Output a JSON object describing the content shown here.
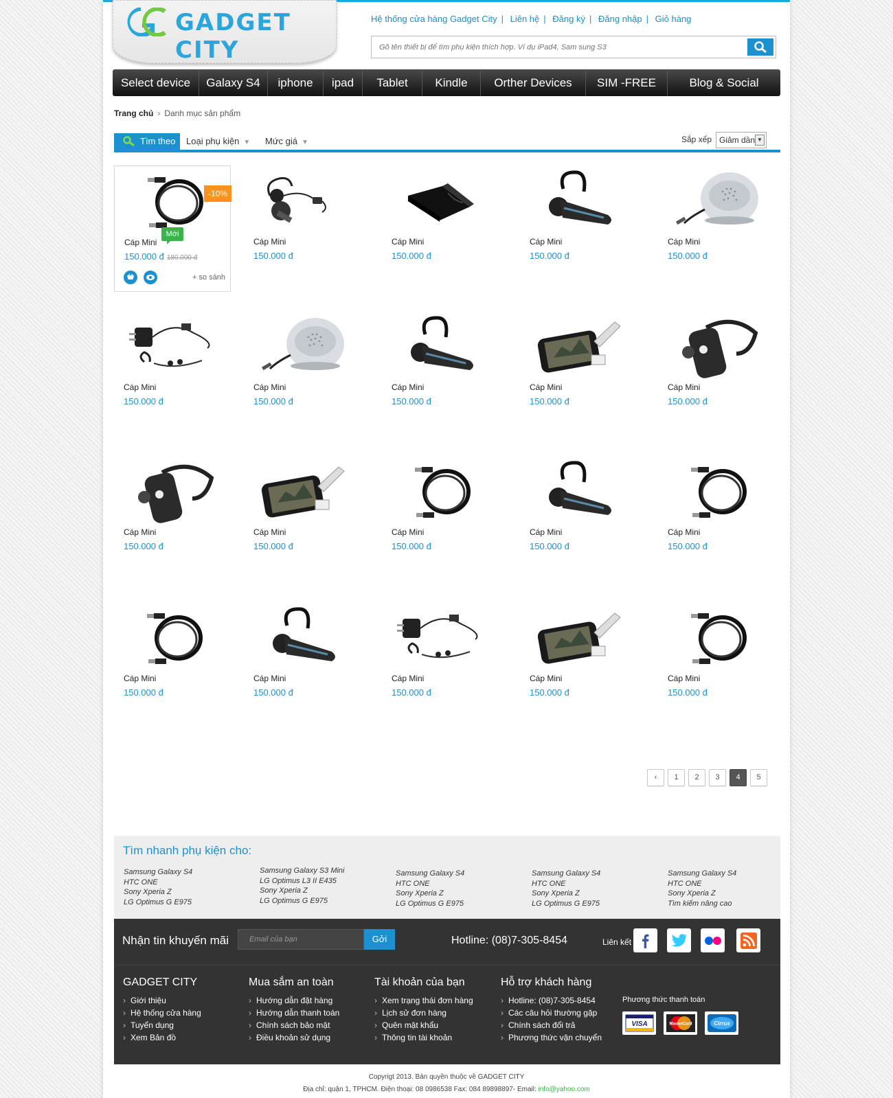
{
  "brand": {
    "name": "GADGET CITY",
    "mark": "GC"
  },
  "top_links": [
    "Hệ thống cửa hàng Gadget City",
    "Liên hệ",
    "Đăng ký",
    "Đăng nhập",
    "Giỏ hàng"
  ],
  "search": {
    "placeholder": "Gõ tên thiết bị để tìm phụ kiện thích hợp. Ví dụ iPad4, Sam sung S3"
  },
  "nav": [
    "Select device",
    "Galaxy S4",
    "iphone",
    "ipad",
    "Tablet",
    "Kindle",
    "Orther Devices",
    "SIM -FREE",
    "Blog & Social"
  ],
  "breadcrumb": {
    "home": "Trang chủ",
    "current": "Danh mục sản phẩm"
  },
  "filter": {
    "find_label": "Tìm theo",
    "type_label": "Loại phụ kiện",
    "price_label": "Mức giá",
    "sort_label": "Sắp xếp",
    "sort_value": "Giảm dần"
  },
  "featured": {
    "discount": "-10%",
    "new_badge": "Mới",
    "old_price": "180.000 đ",
    "compare": "+ so sánh"
  },
  "products": [
    {
      "name": "Cáp Mini",
      "price": "150.000 đ",
      "img": "cable"
    },
    {
      "name": "Cáp Mini",
      "price": "150.000 đ",
      "img": "handsfree"
    },
    {
      "name": "Cáp Mini",
      "price": "150.000 đ",
      "img": "case"
    },
    {
      "name": "Cáp Mini",
      "price": "150.000 đ",
      "img": "headset"
    },
    {
      "name": "Cáp Mini",
      "price": "150.000 đ",
      "img": "speaker"
    },
    {
      "name": "Cáp Mini",
      "price": "150.000 đ",
      "img": "charger"
    },
    {
      "name": "Cáp Mini",
      "price": "150.000 đ",
      "img": "speaker"
    },
    {
      "name": "Cáp Mini",
      "price": "150.000 đ",
      "img": "headset"
    },
    {
      "name": "Cáp Mini",
      "price": "150.000 đ",
      "img": "phone"
    },
    {
      "name": "Cáp Mini",
      "price": "150.000 đ",
      "img": "headset2"
    },
    {
      "name": "Cáp Mini",
      "price": "150.000 đ",
      "img": "headset2"
    },
    {
      "name": "Cáp Mini",
      "price": "150.000 đ",
      "img": "phone"
    },
    {
      "name": "Cáp Mini",
      "price": "150.000 đ",
      "img": "cable"
    },
    {
      "name": "Cáp Mini",
      "price": "150.000 đ",
      "img": "headset"
    },
    {
      "name": "Cáp Mini",
      "price": "150.000 đ",
      "img": "cable"
    },
    {
      "name": "Cáp Mini",
      "price": "150.000 đ",
      "img": "cable"
    },
    {
      "name": "Cáp Mini",
      "price": "150.000 đ",
      "img": "headset"
    },
    {
      "name": "Cáp Mini",
      "price": "150.000 đ",
      "img": "charger"
    },
    {
      "name": "Cáp Mini",
      "price": "150.000 đ",
      "img": "phone"
    },
    {
      "name": "Cáp Mini",
      "price": "150.000 đ",
      "img": "cable"
    }
  ],
  "pagination": {
    "pages": [
      "1",
      "2",
      "3",
      "4",
      "5"
    ],
    "active": "4",
    "prev": "‹"
  },
  "quick_find": {
    "title": "Tìm nhanh phụ kiện cho:",
    "columns": [
      [
        "Samsung Galaxy S4",
        "HTC ONE",
        "Sony Xperia Z",
        "LG Optimus G E975"
      ],
      [
        "Samsung Galaxy S3 Mini",
        "LG Optimus L3 II E435",
        "Sony Xperia Z",
        "LG Optimus G E975"
      ],
      [
        "Samsung Galaxy S4",
        "HTC ONE",
        "Sony Xperia Z",
        "LG Optimus G E975"
      ],
      [
        "Samsung Galaxy S4",
        "HTC ONE",
        "Sony Xperia Z",
        "LG Optimus G E975"
      ],
      [
        "Samsung Galaxy S4",
        "HTC ONE",
        "Sony Xperia Z",
        "Tìm kiếm nâng cao"
      ]
    ]
  },
  "newsletter": {
    "label": "Nhận tin khuyến mãi",
    "placeholder": "Email của bạn",
    "button": "Gởi"
  },
  "hotline": "Hotline: (08)7-305-8454",
  "links_label": "Liên kết",
  "footer_columns": [
    {
      "title": "GADGET CITY",
      "items": [
        "Giới thiệu",
        "Hệ thống cửa hàng",
        "Tuyển dụng",
        "Xem Bản đồ"
      ]
    },
    {
      "title": "Mua sắm an toàn",
      "items": [
        "Hướng dẫn đặt hàng",
        "Hướng dẫn thanh toán",
        "Chính sách bảo mật",
        "Điều khoản sử dụng"
      ]
    },
    {
      "title": "Tài khoản của bạn",
      "items": [
        "Xem trạng thái đơn hàng",
        "Lịch sử đơn hàng",
        "Quên mật khẩu",
        "Thông tin tài khoản"
      ]
    },
    {
      "title": "Hỗ trợ khách hàng",
      "items": [
        "Hotline: (08)7-305-8454",
        "Các câu hỏi thường gặp",
        "Chính sách đổi trả",
        "Phương thức vận chuyển"
      ]
    }
  ],
  "payment": {
    "label": "Phương thức thanh toán",
    "cards": [
      "VISA",
      "MasterCard",
      "Cirrus"
    ]
  },
  "copyright": {
    "line1": "Copyrigt 2013.  Bản quyền thuộc về GADGET CITY",
    "line2": "Địa chỉ:  quận 1, TPHCM. Điện thoại: 08 0986538  Fax: 084 89898897- Email: ",
    "email": "info@yahoo.com"
  },
  "colors": {
    "accent": "#1d91cf",
    "discount": "#f7931e",
    "new": "#39b44a",
    "footer": "#333333"
  }
}
